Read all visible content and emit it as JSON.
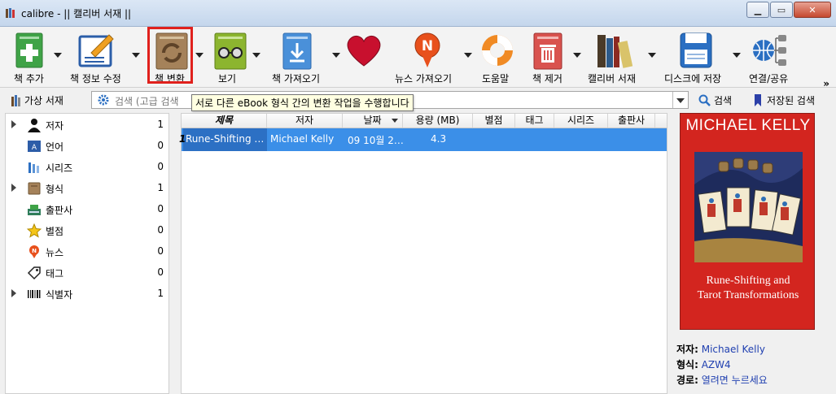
{
  "window": {
    "title": "calibre - || 캘리버 서재 ||"
  },
  "toolbar": {
    "items": [
      {
        "label": "책 추가",
        "icon": "add-book-icon"
      },
      {
        "label": "책 정보 수정",
        "icon": "edit-metadata-icon"
      },
      {
        "label": "책 변환",
        "icon": "convert-books-icon"
      },
      {
        "label": "보기",
        "icon": "view-icon"
      },
      {
        "label": "책 가져오기",
        "icon": "get-books-icon"
      },
      {
        "label": "",
        "icon": "donate-heart-icon"
      },
      {
        "label": "뉴스 가져오기",
        "icon": "fetch-news-icon"
      },
      {
        "label": "도움말",
        "icon": "help-lifebuoy-icon"
      },
      {
        "label": "책 제거",
        "icon": "remove-books-icon"
      },
      {
        "label": "캘리버 서재",
        "icon": "calibre-library-icon"
      },
      {
        "label": "디스크에 저장",
        "icon": "save-to-disk-icon"
      },
      {
        "label": "연결/공유",
        "icon": "connect-share-icon"
      }
    ],
    "overflow": "»"
  },
  "tooltip": "서로 다른 eBook 형식 간의 변환 작업을 수행합니다",
  "searchbar": {
    "virtual_library": "가상 서재",
    "placeholder": "검색 (고급 검색",
    "search_button": "검색",
    "saved_search_button": "저장된 검색"
  },
  "tag_browser": [
    {
      "name": "저자",
      "count": "1",
      "expandable": true,
      "icon": "person-icon"
    },
    {
      "name": "언어",
      "count": "0",
      "expandable": false,
      "icon": "language-icon"
    },
    {
      "name": "시리즈",
      "count": "0",
      "expandable": false,
      "icon": "series-icon"
    },
    {
      "name": "형식",
      "count": "1",
      "expandable": true,
      "icon": "format-book-icon"
    },
    {
      "name": "출판사",
      "count": "0",
      "expandable": false,
      "icon": "publisher-icon"
    },
    {
      "name": "별점",
      "count": "0",
      "expandable": false,
      "icon": "star-icon"
    },
    {
      "name": "뉴스",
      "count": "0",
      "expandable": false,
      "icon": "news-icon"
    },
    {
      "name": "태그",
      "count": "0",
      "expandable": false,
      "icon": "tag-icon"
    },
    {
      "name": "식별자",
      "count": "1",
      "expandable": true,
      "icon": "barcode-icon"
    }
  ],
  "book_list": {
    "columns": [
      "제목",
      "저자",
      "날짜",
      "용량 (MB)",
      "별점",
      "태그",
      "시리즈",
      "출판사"
    ],
    "rows": [
      {
        "marker": "1",
        "title": "Rune-Shifting …",
        "author": "Michael Kelly",
        "date": "09 10월 2…",
        "size": "4.3"
      }
    ]
  },
  "book_details": {
    "cover_author": "MICHAEL KELLY",
    "cover_title_line1": "Rune-Shifting and",
    "cover_title_line2": "Tarot Transformations",
    "cover_color": "#d3251f",
    "author_label": "저자:",
    "author_value": "Michael Kelly",
    "format_label": "형식:",
    "format_value": "AZW4",
    "path_label": "경로:",
    "path_value": "열려면 누르세요"
  }
}
